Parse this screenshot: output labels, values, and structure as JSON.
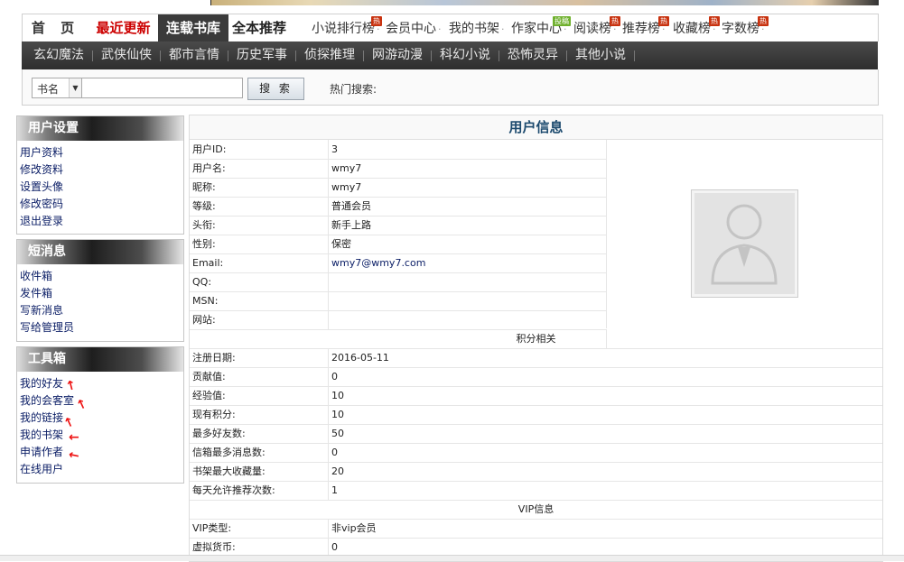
{
  "nav": {
    "home": "首 页",
    "latest": "最近更新",
    "serial": "连载书库",
    "full": "全本推荐",
    "links": [
      {
        "label": "小说排行榜",
        "badge": "热"
      },
      {
        "label": "会员中心",
        "badge": ""
      },
      {
        "label": "我的书架",
        "badge": ""
      },
      {
        "label": "作家中心",
        "badge": "投稿"
      },
      {
        "label": "阅读榜",
        "badge": "热"
      },
      {
        "label": "推荐榜",
        "badge": "热"
      },
      {
        "label": "收藏榜",
        "badge": "热"
      },
      {
        "label": "字数榜",
        "badge": "热"
      }
    ]
  },
  "categories": [
    "玄幻魔法",
    "武侠仙侠",
    "都市言情",
    "历史军事",
    "侦探推理",
    "网游动漫",
    "科幻小说",
    "恐怖灵异",
    "其他小说"
  ],
  "search": {
    "select_value": "书名",
    "button": "搜 索",
    "hot_label": "热门搜索:"
  },
  "sidebar": {
    "user_settings": {
      "title": "用户设置",
      "items": [
        "用户资料",
        "修改资料",
        "设置头像",
        "修改密码",
        "退出登录"
      ]
    },
    "messages": {
      "title": "短消息",
      "items": [
        "收件箱",
        "发件箱",
        "写新消息",
        "写给管理员"
      ]
    },
    "toolbox": {
      "title": "工具箱",
      "items": [
        "我的好友",
        "我的会客室",
        "我的链接",
        "我的书架",
        "申请作者",
        "在线用户"
      ]
    }
  },
  "user_info": {
    "title": "用户信息",
    "basic": [
      {
        "k": "用户ID:",
        "v": "3"
      },
      {
        "k": "用户名:",
        "v": "wmy7"
      },
      {
        "k": "昵称:",
        "v": "wmy7"
      },
      {
        "k": "等级:",
        "v": "普通会员"
      },
      {
        "k": "头衔:",
        "v": "新手上路"
      },
      {
        "k": "性别:",
        "v": "保密"
      },
      {
        "k": "Email:",
        "v": "wmy7@wmy7.com"
      },
      {
        "k": "QQ:",
        "v": ""
      },
      {
        "k": "MSN:",
        "v": ""
      },
      {
        "k": "网站:",
        "v": ""
      }
    ],
    "points_title": "积分相关",
    "points": [
      {
        "k": "注册日期:",
        "v": "2016-05-11"
      },
      {
        "k": "贡献值:",
        "v": "0"
      },
      {
        "k": "经验值:",
        "v": "10"
      },
      {
        "k": "现有积分:",
        "v": "10"
      },
      {
        "k": "最多好友数:",
        "v": "50"
      },
      {
        "k": "信箱最多消息数:",
        "v": "0"
      },
      {
        "k": "书架最大收藏量:",
        "v": "20"
      },
      {
        "k": "每天允许推荐次数:",
        "v": "1"
      }
    ],
    "vip_title": "VIP信息",
    "vip": [
      {
        "k": "VIP类型:",
        "v": "非vip会员"
      },
      {
        "k": "虚拟货币:",
        "v": "0"
      }
    ]
  },
  "colors": {
    "accent_red": "#cc0000",
    "title_blue": "#1c4a6e",
    "link_blue": "#0b1e66",
    "dark_bar": "#3b3b3b"
  }
}
